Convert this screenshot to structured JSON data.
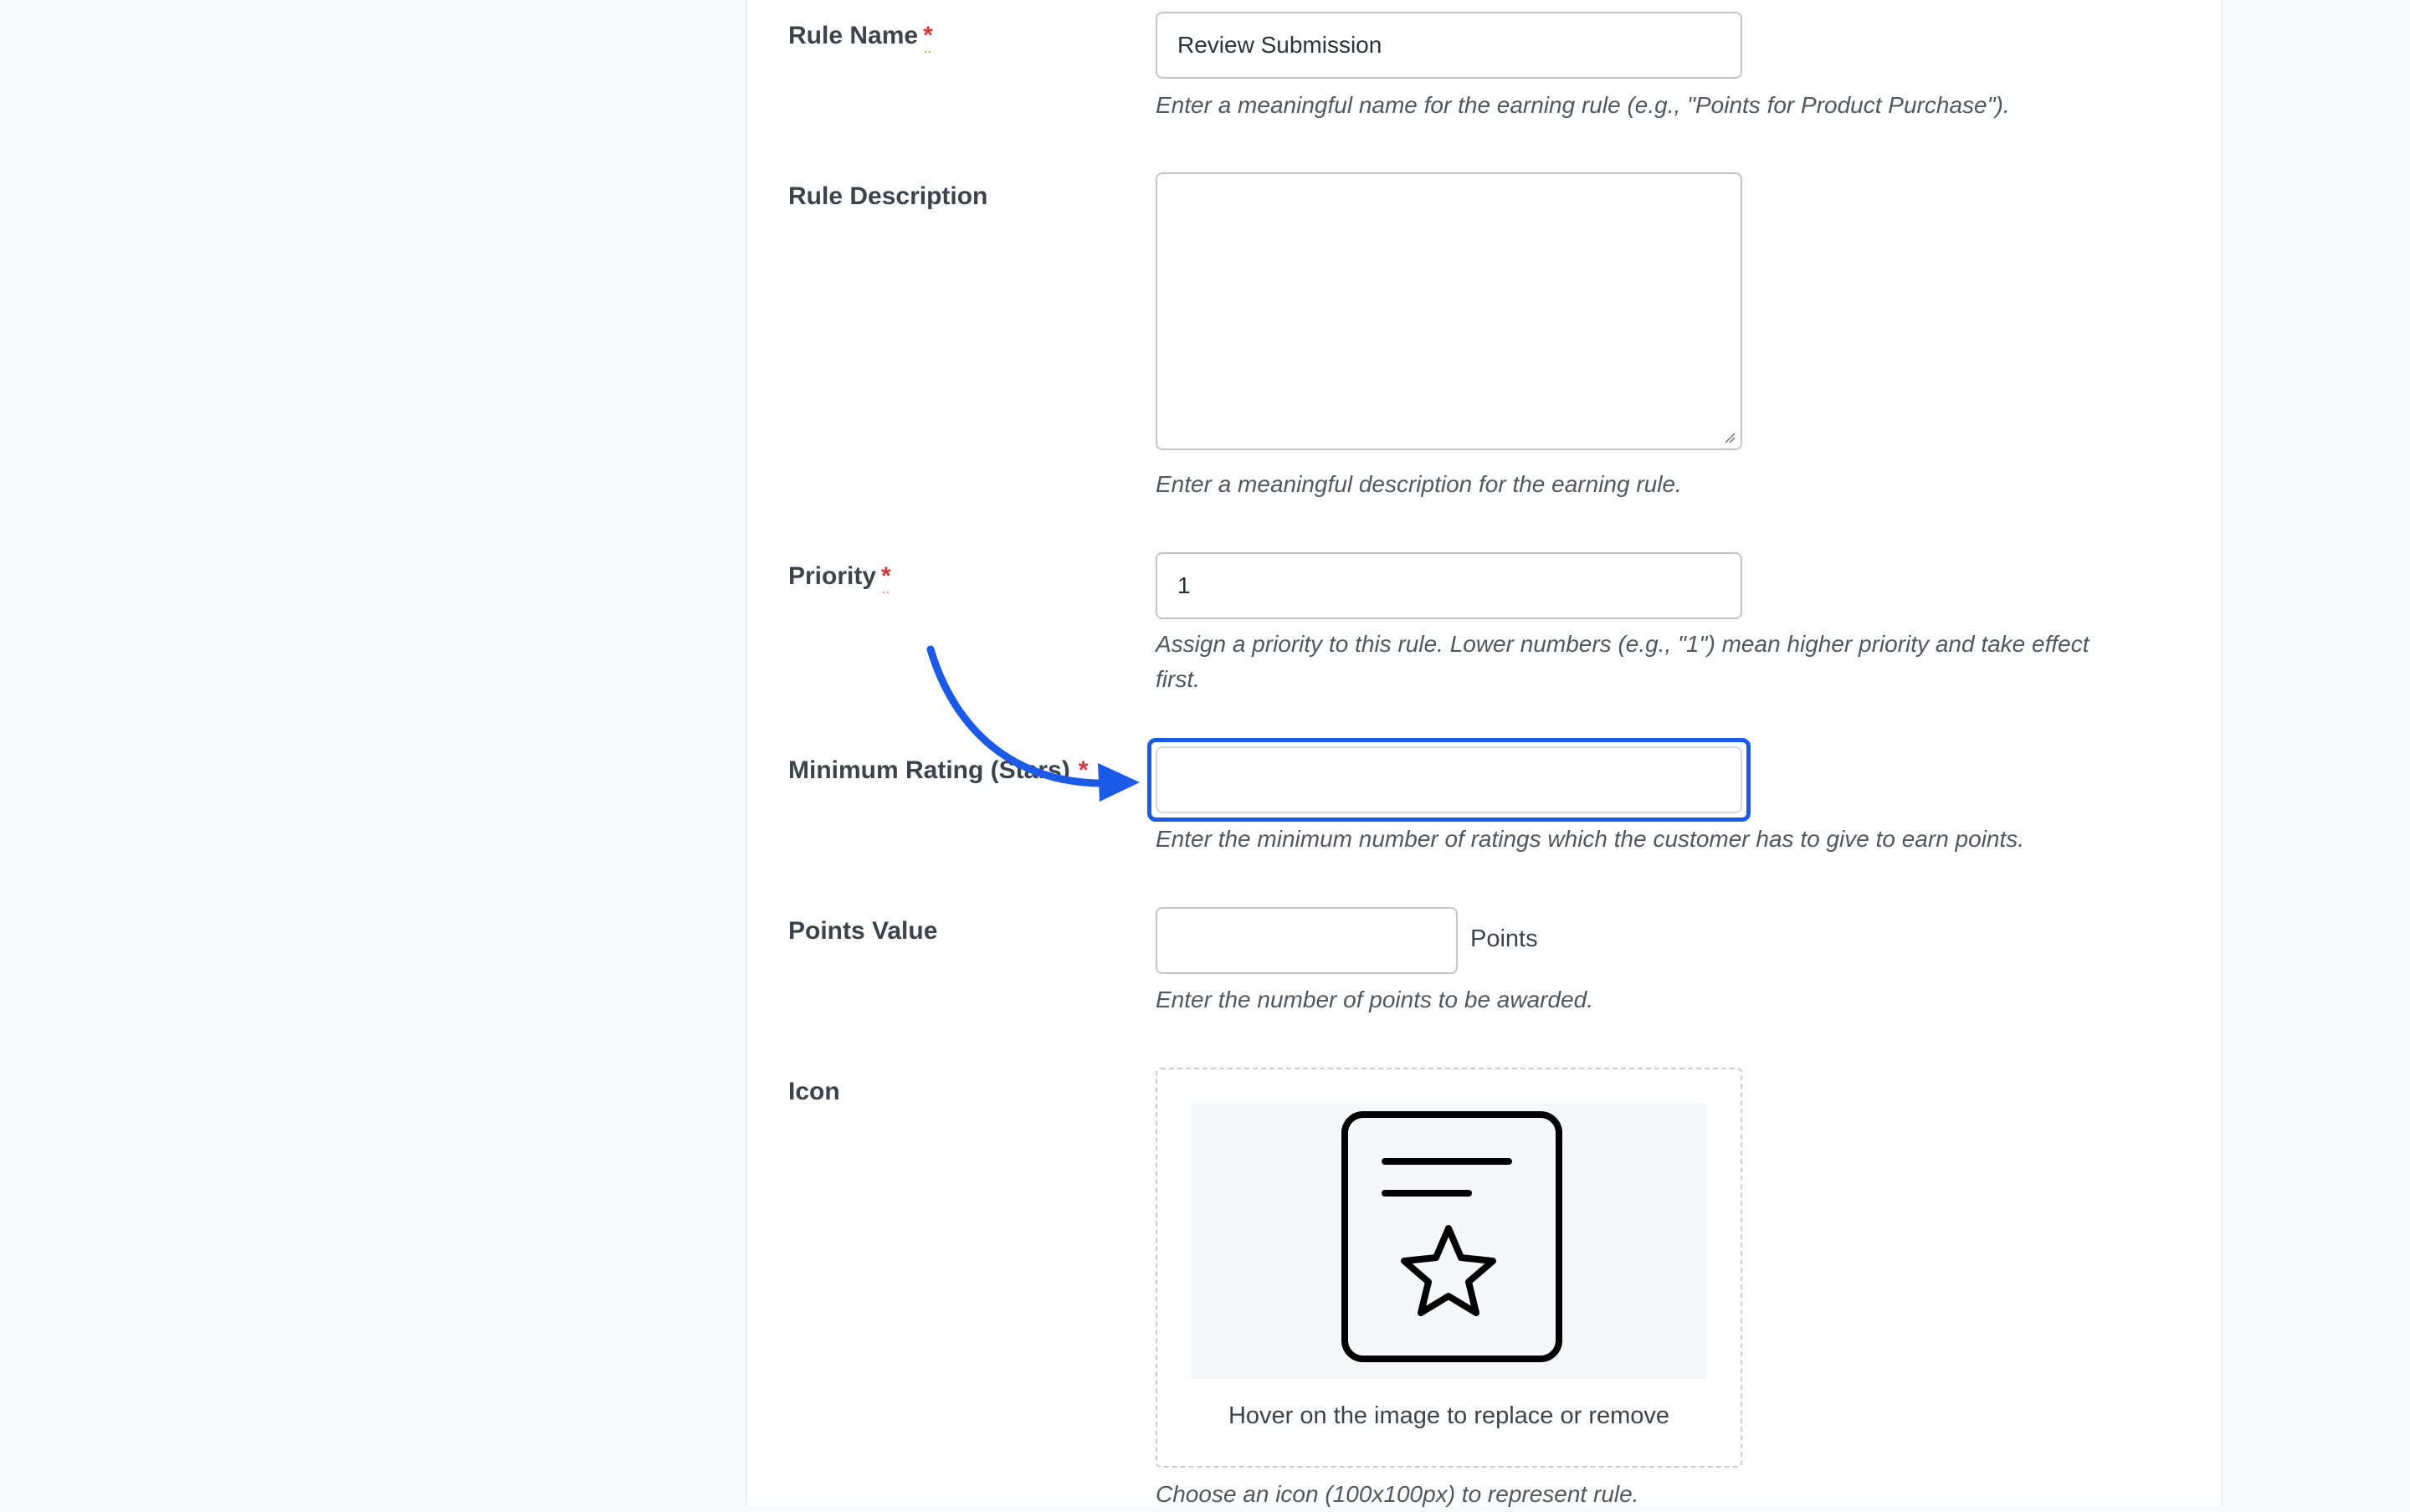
{
  "form": {
    "rule_name": {
      "label": "Rule Name",
      "required_mark": "*",
      "value": "Review Submission",
      "help": "Enter a meaningful name for the earning rule (e.g., \"Points for Product Purchase\")."
    },
    "rule_description": {
      "label": "Rule Description",
      "value": "",
      "help": "Enter a meaningful description for the earning rule."
    },
    "priority": {
      "label": "Priority",
      "required_mark": "*",
      "value": "1",
      "help_line1": "Assign a priority to this rule. Lower numbers (e.g., \"1\") mean higher priority and take effect",
      "help_line2": "first."
    },
    "minimum_rating": {
      "label": "Minimum Rating (Stars)",
      "required_mark": "*",
      "value": "",
      "help": "Enter the minimum number of ratings which the customer has to give to earn points."
    },
    "points_value": {
      "label": "Points Value",
      "value": "",
      "suffix": "Points",
      "help": "Enter the number of points to be awarded."
    },
    "icon": {
      "label": "Icon",
      "image": "review-star-document-icon",
      "caption": "Hover on the image to replace or remove",
      "help": "Choose an icon (100x100px) to represent rule."
    }
  },
  "annotation": {
    "arrow_color": "#1a5ae6",
    "focus_color": "#1a5ae6"
  },
  "colors": {
    "required": "#d63638",
    "background": "#f8f9fb"
  }
}
